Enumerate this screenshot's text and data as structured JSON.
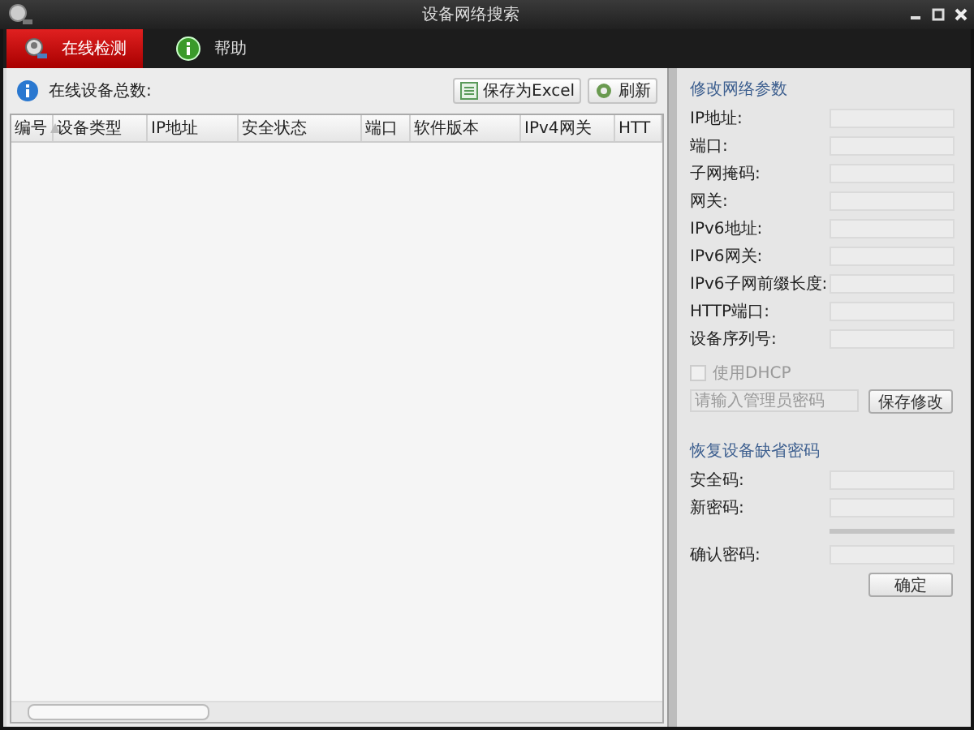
{
  "window": {
    "title": "设备网络搜索"
  },
  "tabs": [
    {
      "label": "在线检测",
      "selected": true,
      "kind": "search"
    },
    {
      "label": "帮助",
      "selected": false,
      "kind": "info"
    }
  ],
  "device_panel": {
    "count_label": "在线设备总数:",
    "buttons": [
      {
        "label": "保存为Excel",
        "kind": "excel"
      },
      {
        "label": "刷新",
        "kind": "refresh"
      }
    ],
    "table": {
      "columns": [
        {
          "label": "编号",
          "sorted": true
        },
        {
          "label": "设备类型",
          "sorted": false
        },
        {
          "label": "IP地址",
          "sorted": false
        },
        {
          "label": "安全状态",
          "sorted": false
        },
        {
          "label": "端口",
          "sorted": false
        },
        {
          "label": "软件版本",
          "sorted": false
        },
        {
          "label": "IPv4网关",
          "sorted": false
        },
        {
          "label": "HTT",
          "sorted": false
        }
      ]
    }
  },
  "network_params": {
    "title": "修改网络参数",
    "fields": [
      {
        "label": "IP地址:"
      },
      {
        "label": "端口:"
      },
      {
        "label": "子网掩码:"
      },
      {
        "label": "网关:"
      },
      {
        "label": "IPv6地址:"
      },
      {
        "label": "IPv6网关:"
      },
      {
        "label": "IPv6子网前缀长度:"
      },
      {
        "label": "HTTP端口:"
      },
      {
        "label": "设备序列号:"
      }
    ],
    "dhcp": {
      "label": "使用DHCP",
      "checked": false,
      "disabled": true
    },
    "password": {
      "placeholder": "请输入管理员密码"
    },
    "save_button": "保存修改"
  },
  "restore_password": {
    "title": "恢复设备缺省密码",
    "fields": [
      {
        "label": "安全码:",
        "kind": "field"
      },
      {
        "label": "新密码:",
        "kind": "field"
      },
      {
        "kind": "meter"
      },
      {
        "label": "确认密码:",
        "kind": "field"
      }
    ],
    "confirm_button": "确定"
  }
}
